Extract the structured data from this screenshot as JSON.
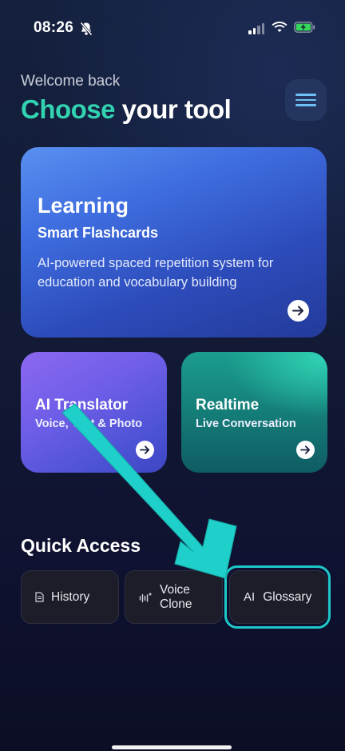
{
  "status_bar": {
    "time": "08:26"
  },
  "header": {
    "welcome": "Welcome back",
    "title_accent": "Choose",
    "title_rest": " your tool"
  },
  "cards": {
    "learning": {
      "title": "Learning",
      "subtitle": "Smart Flashcards",
      "description": "AI-powered spaced repetition system for education and vocabulary building"
    },
    "translator": {
      "title": "AI Translator",
      "subtitle": "Voice, Text & Photo"
    },
    "realtime": {
      "title": "Realtime",
      "subtitle": "Live Conversation"
    }
  },
  "quick_access": {
    "title": "Quick Access",
    "history": "History",
    "voice_clone": "Voice Clone",
    "glossary_icon_text": "AI",
    "glossary": "Glossary"
  },
  "colors": {
    "accent": "#31d3b0",
    "highlight": "#1ec8c8",
    "menu_icon": "#6fc0f4"
  }
}
